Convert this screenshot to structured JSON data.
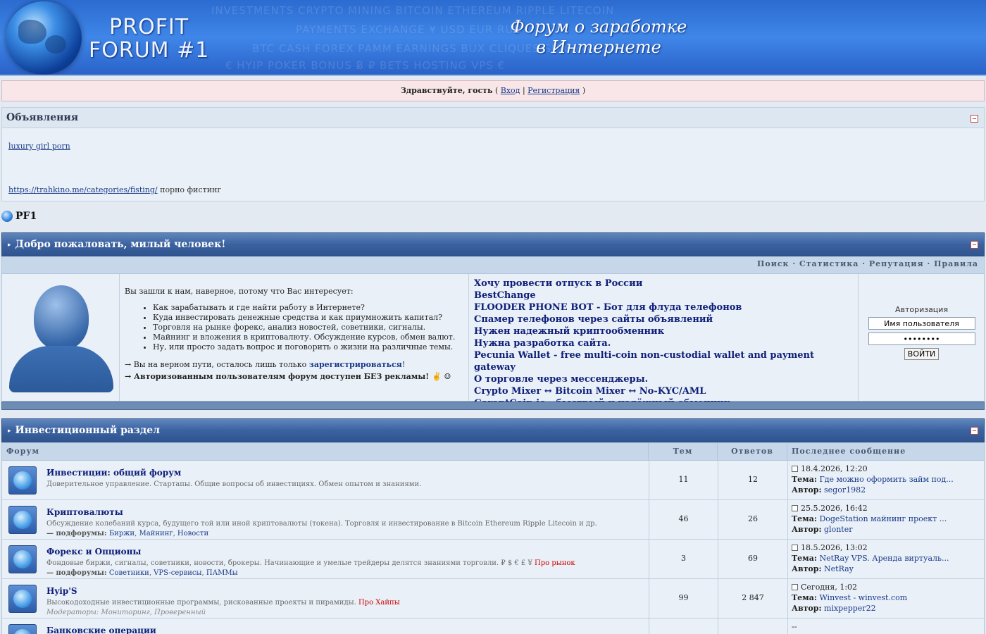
{
  "header": {
    "logo_line1": "PROFIT",
    "logo_line2": "FORUM #1",
    "slogan_line1": "Форум о заработке",
    "slogan_line2": "в Интернете",
    "bg_words_row1": "INVESTMENTS      CRYPTO MINING      BITCOIN                                        ETHEREUM      RIPPLE      LITECOIN",
    "bg_words_row2": "PAYMENTS      EXCHANGE                                                    ¥      USD      EUR      RUB",
    "bg_words_row3": "BTC      CASH      FOREX      PAMM                                       EARNINGS      BUX      CLIQUES      SURFING",
    "bg_words_row4": "€      HYIP      POKER      BONUS      Ƀ                                    ₽      BETS      HOSTING      VPS      €"
  },
  "welcome_bar": {
    "greeting": "Здравствуйте, гость",
    "open": "(",
    "login": "Вход",
    "sep": "|",
    "register": "Регистрация",
    "close": ")"
  },
  "announcements": {
    "title": "Объявления",
    "link1": "luxury girl porn",
    "link2": "https://trahkino.me/categories/fisting/",
    "link2_suffix": " порно фистинг"
  },
  "breadcrumb": "PF1",
  "welcome_block": {
    "title": "Добро пожаловать, милый человек!",
    "nav": "Поиск · Статистика · Репутация · Правила",
    "intro": "Вы зашли к нам, наверное, потому что Вас интересует:",
    "bullets": [
      "Как зарабатывать и где найти работу в Интернете?",
      "Куда инвестировать денежные средства и как приумножить капитал?",
      "Торговля на рынке форекс, анализ новостей, советники, сигналы.",
      "Майнинг и вложения в криптовалюту. Обсуждение курсов, обмен валют.",
      "Ну, или просто задать вопрос и поговорить о жизни на различные темы."
    ],
    "reg_text": "→ Вы на верном пути, осталось лишь только ",
    "reg_link": "зарегистрироваться",
    "reg_end": "!",
    "noads": "→ Авторизованным пользователям форум доступен БЕЗ рекламы! ✌ ☺",
    "promo_links": [
      "Хочу провести отпуск в России",
      "BestChange",
      "FLOODER PHONE BOT - Бот для флуда телефонов",
      "Спамер телефонов через сайты объявлений",
      "Нужен надежный криптообменник",
      "Нужна разработка сайта.",
      "Pecunia Wallet - free multi-coin non-custodial wallet and payment gateway",
      "О торговле через мессенджеры.",
      "Crypto Mixer ↔ Bitcoin Mixer ↔ No-KYC/AML",
      "GarantCoin.io - быстрый и надёжный обменник"
    ],
    "auth": {
      "label": "Авторизация",
      "username_value": "Имя пользователя",
      "password_value": "••••••••",
      "button": "ВОЙТИ"
    }
  },
  "invest": {
    "title": "Инвестиционный раздел",
    "columns": {
      "forum": "Форум",
      "topics": "Тем",
      "posts": "Ответов",
      "last": "Последнее сообщение"
    },
    "forums": [
      {
        "name": "Инвестиции: общий форум",
        "desc": "Доверительное управление. Стартапы. Общие вопросы об инвестициях. Обмен опытом и знаниями.",
        "topics": "11",
        "posts": "12",
        "last_date": "18.4.2026, 12:20",
        "last_topic": "Где можно оформить займ под...",
        "last_author": "segor1982"
      },
      {
        "name": "Криптовалюты",
        "desc": "Обсуждение колебаний курса, будущего той или иной криптовалюты (токена). Торговля и инвестирование в Bitcoin  Ethereum Ripple Litecoin и др.",
        "sub_label": "— подфорумы:",
        "subs": [
          "Биржи",
          "Майнинг",
          "Новости"
        ],
        "topics": "46",
        "posts": "26",
        "last_date": "25.5.2026, 16:42",
        "last_topic": "DogeStation майнинг проект ...",
        "last_author": "glonter"
      },
      {
        "name": "Форекс и Опционы",
        "desc": "Фондовые биржи, сигналы, советники, новости, брокеры. Начинающие и умелые трейдеры делятся знаниями торговли. ₽ $ € £ ¥",
        "desc_red": " Про рынок",
        "sub_label": "— подфорумы:",
        "subs": [
          "Советники",
          "VPS-сервисы",
          "ПАММы"
        ],
        "topics": "3",
        "posts": "69",
        "last_date": "18.5.2026, 13:02",
        "last_topic": "NetRay VPS. Аренда виртуаль...",
        "last_author": "NetRay"
      },
      {
        "name": "Hyip'S",
        "desc": "Высокодоходные инвестиционные программы, рискованные проекты и пирамиды.",
        "desc_red": " Про Хайпы",
        "mods": "Модераторы: Мониторинг, Проверенный",
        "topics": "99",
        "posts": "2 847",
        "last_date": "Сегодня, 1:02",
        "last_topic": "Winvest - winvest.com",
        "last_author": "mixpepper22"
      },
      {
        "name": "Банковские операции",
        "last_date": "--"
      }
    ],
    "labels": {
      "topic": "Тема:",
      "author": "Автор:"
    }
  }
}
